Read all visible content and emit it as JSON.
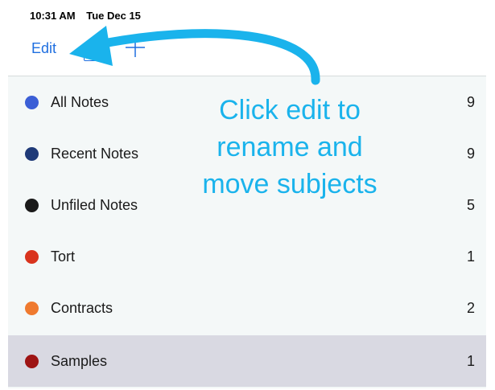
{
  "status_bar": {
    "time": "10:31 AM",
    "date": "Tue Dec 15"
  },
  "toolbar": {
    "edit_label": "Edit",
    "folder_icon": "folder-icon",
    "add_icon": "plus-icon"
  },
  "subjects": [
    {
      "label": "All Notes",
      "count": "9",
      "color": "#3b5fd6"
    },
    {
      "label": "Recent Notes",
      "count": "9",
      "color": "#1f3a78"
    },
    {
      "label": "Unfiled Notes",
      "count": "5",
      "color": "#1a1a1a"
    },
    {
      "label": "Tort",
      "count": "1",
      "color": "#d9341e"
    },
    {
      "label": "Contracts",
      "count": "2",
      "color": "#ef7a2f"
    },
    {
      "label": "Samples",
      "count": "1",
      "color": "#9e1414",
      "selected": true
    }
  ],
  "annotation": {
    "lines": [
      "Click edit to",
      "rename and",
      "move subjects"
    ],
    "color": "#1ab3ec"
  }
}
